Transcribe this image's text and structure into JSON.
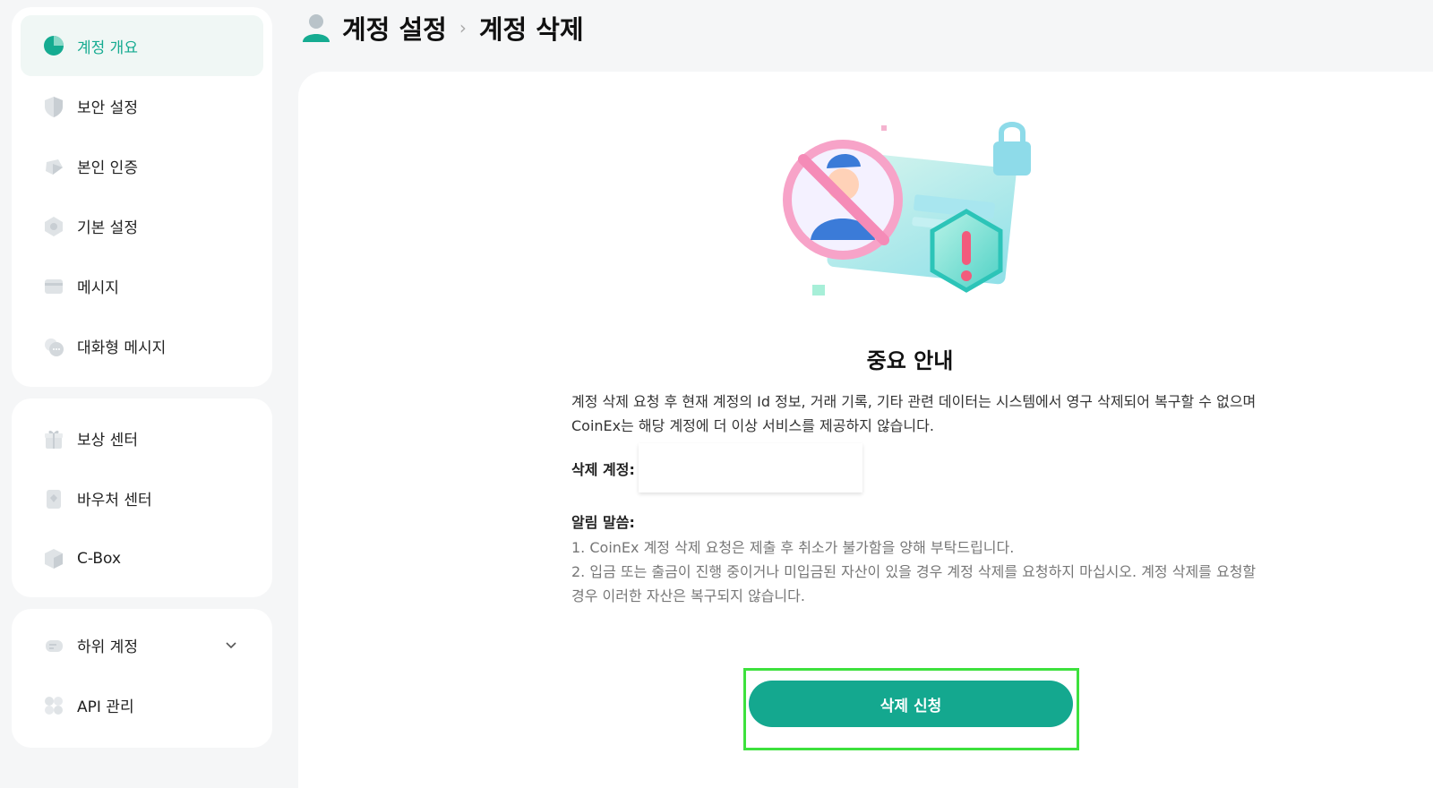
{
  "header": {
    "crumb_root": "계정 설정",
    "crumb_current": "계정 삭제"
  },
  "sidebar": {
    "group1": [
      {
        "label": "계정 개요",
        "icon": "pie-chart-icon",
        "active": true
      },
      {
        "label": "보안 설정",
        "icon": "shield-icon"
      },
      {
        "label": "본인 인증",
        "icon": "id-verify-icon"
      },
      {
        "label": "기본 설정",
        "icon": "settings-icon"
      },
      {
        "label": "메시지",
        "icon": "message-icon"
      },
      {
        "label": "대화형 메시지",
        "icon": "chat-icon"
      }
    ],
    "group2": [
      {
        "label": "보상 센터",
        "icon": "gift-icon"
      },
      {
        "label": "바우처 센터",
        "icon": "voucher-icon"
      },
      {
        "label": "C-Box",
        "icon": "box-icon"
      }
    ],
    "group3": [
      {
        "label": "하위 계정",
        "icon": "sub-account-icon"
      },
      {
        "label": "API 관리",
        "icon": "api-icon"
      }
    ]
  },
  "main": {
    "title": "중요 안내",
    "description": "계정 삭제 요청 후 현재 계정의 Id 정보, 거래 기록, 기타 관련 데이터는 시스템에서 영구 삭제되어 복구할 수 없으며 CoinEx는 해당 계정에 더 이상 서비스를 제공하지 않습니다.",
    "field_label": "삭제 계정:",
    "field_value": "",
    "notice_title": "알림 말씀:",
    "notice_1": "1. CoinEx 계정 삭제 요청은 제출 후 취소가 불가함을 양해 부탁드립니다.",
    "notice_2": "2. 입금 또는 출금이 진행 중이거나 미입금된 자산이 있을 경우 계정 삭제를 요청하지 마십시오. 계정 삭제를 요청할 경우 이러한 자산은 복구되지 않습니다.",
    "submit_label": "삭제 신청"
  },
  "colors": {
    "accent": "#15ab91",
    "button": "#14a88f",
    "highlight_box": "#3de13d"
  }
}
